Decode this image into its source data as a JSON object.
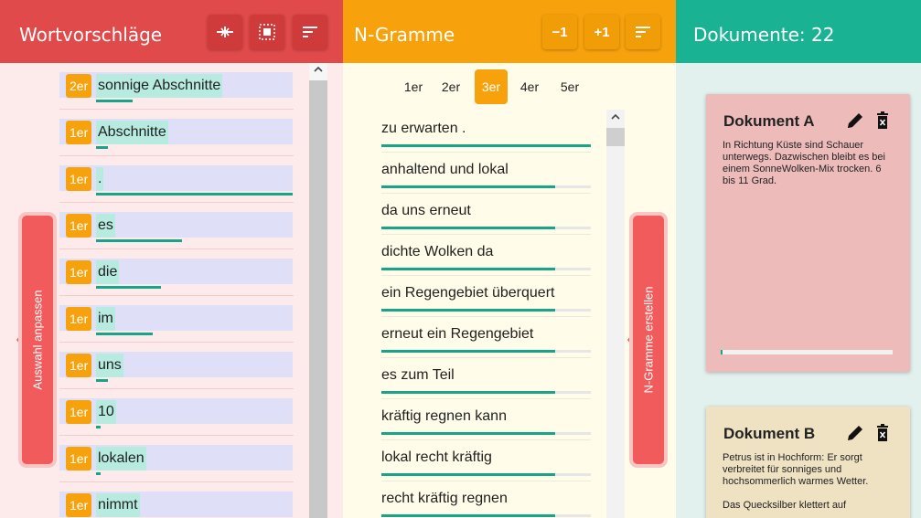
{
  "word_panel": {
    "title": "Wortvorschläge",
    "side_button": "Auswahl anpassen",
    "items": [
      {
        "badge": "2er",
        "text": "sonnige Abschnitte",
        "bar": 0.16
      },
      {
        "badge": "1er",
        "text": "Abschnitte",
        "bar": 0.06
      },
      {
        "badge": "1er",
        "text": ".",
        "bar": 1.0
      },
      {
        "badge": "1er",
        "text": "es",
        "bar": 0.43
      },
      {
        "badge": "1er",
        "text": "die",
        "bar": 0.32
      },
      {
        "badge": "1er",
        "text": "im",
        "bar": 0.28
      },
      {
        "badge": "1er",
        "text": "uns",
        "bar": 0.06
      },
      {
        "badge": "1er",
        "text": "10",
        "bar": 0.02
      },
      {
        "badge": "1er",
        "text": "lokalen",
        "bar": 0.02
      },
      {
        "badge": "1er",
        "text": "nimmt",
        "bar": 0.02
      }
    ]
  },
  "ngram_panel": {
    "title": "N-Gramme",
    "btn_minus": "−1",
    "btn_plus": "+1",
    "side_button": "N-Gramme erstellen",
    "tabs": [
      {
        "label": "1er",
        "active": false
      },
      {
        "label": "2er",
        "active": false
      },
      {
        "label": "3er",
        "active": true
      },
      {
        "label": "4er",
        "active": false
      },
      {
        "label": "5er",
        "active": false
      }
    ],
    "items": [
      {
        "text": "zu erwarten .",
        "fill": 1.0
      },
      {
        "text": "anhaltend und lokal",
        "fill": 0.83
      },
      {
        "text": "da uns erneut",
        "fill": 0.83
      },
      {
        "text": "dichte Wolken da",
        "fill": 0.83
      },
      {
        "text": "ein Regengebiet überquert",
        "fill": 0.83
      },
      {
        "text": "erneut ein Regengebiet",
        "fill": 0.83
      },
      {
        "text": "es zum Teil",
        "fill": 0.83
      },
      {
        "text": "kräftig regnen kann",
        "fill": 0.83
      },
      {
        "text": "lokal recht kräftig",
        "fill": 0.83
      },
      {
        "text": "recht kräftig regnen",
        "fill": 0.83
      }
    ]
  },
  "doc_panel": {
    "title": "Dokumente: 22",
    "documents": [
      {
        "title": "Dokument A",
        "paragraphs": [
          "In Richtung Küste sind Schauer unterwegs. Dazwischen bleibt es bei einem SonneWolken-Mix trocken. 6 bis 11 Grad."
        ],
        "progress": 0.01
      },
      {
        "title": "Dokument B",
        "paragraphs": [
          "Petrus ist in Hochform: Er sorgt verbreitet für sonniges und hochsommerlich warmes Wetter.",
          "Das Quecksilber klettert auf"
        ],
        "progress": null
      }
    ]
  },
  "colors": {
    "red_header": "#e04a4a",
    "orange_header": "#f7a20c",
    "teal_header": "#19b394",
    "bar_green": "#17a58a",
    "badge_orange": "#f7a20c"
  }
}
